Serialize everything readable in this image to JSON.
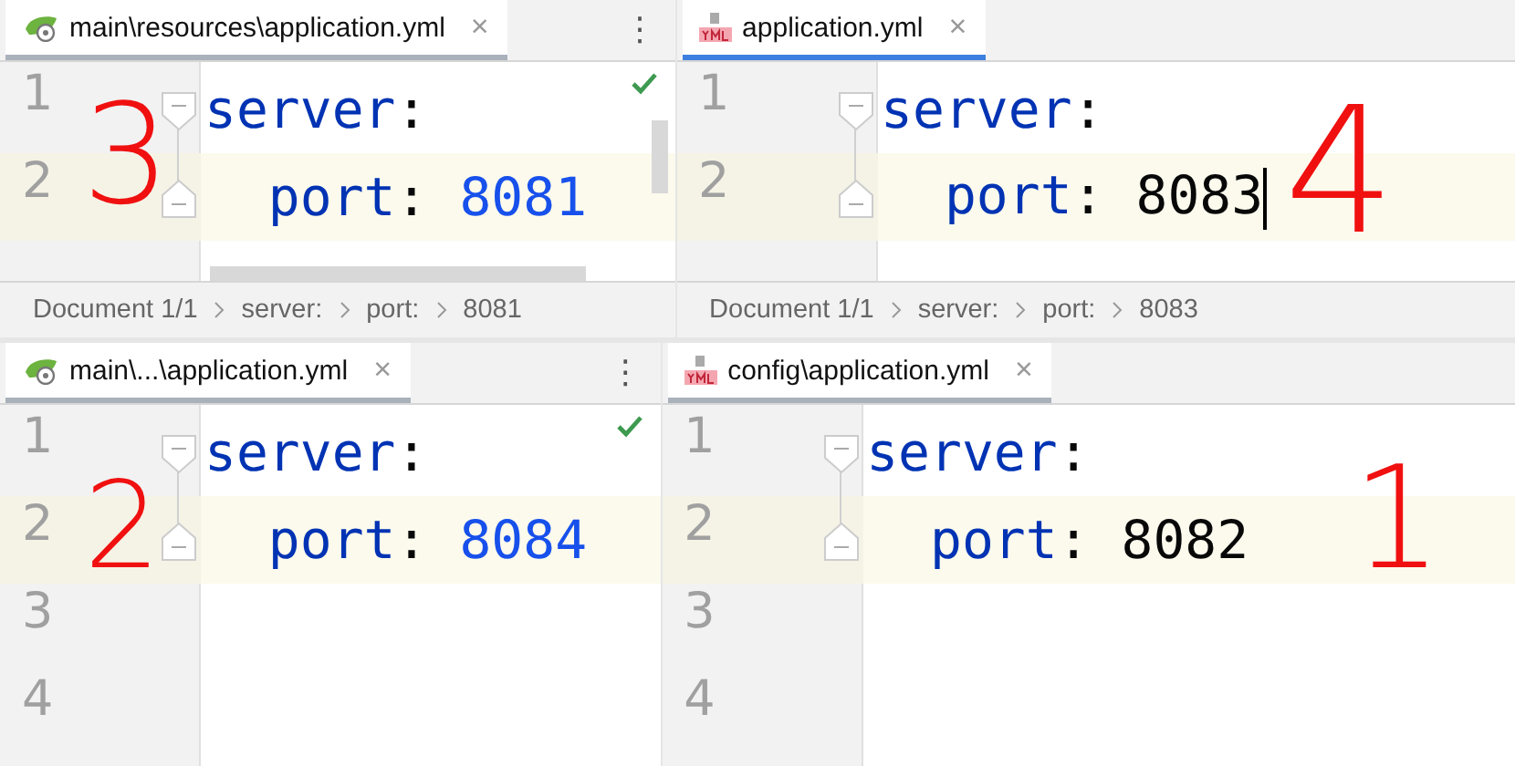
{
  "panes": [
    {
      "tab": {
        "kind": "spring",
        "label": "main\\resources\\application.yml",
        "close": "×",
        "selected": false
      },
      "menu": "⋮",
      "inspection_ok": true,
      "scrollbars": true,
      "line_numbers": [
        "1",
        "2"
      ],
      "code": [
        {
          "key": "server",
          "sep": ":",
          "current": false,
          "children": [
            {
              "key": "port",
              "sep": ":",
              "value": "8081",
              "kind": "number",
              "current": true,
              "caret": false
            }
          ]
        }
      ],
      "breadcrumbs": [
        "Document 1/1",
        "server:",
        "port:",
        "8081"
      ],
      "note": "3"
    },
    {
      "tab": {
        "kind": "yml",
        "label": "application.yml",
        "close": "×",
        "selected": true
      },
      "inspection_ok": false,
      "scrollbars": false,
      "line_numbers": [
        "1",
        "2"
      ],
      "code": [
        {
          "key": "server",
          "sep": ":",
          "current": false,
          "children": [
            {
              "key": "port",
              "sep": ":",
              "value": "8083",
              "kind": "plain",
              "current": true,
              "caret": true
            }
          ]
        }
      ],
      "breadcrumbs": [
        "Document 1/1",
        "server:",
        "port:",
        "8083"
      ],
      "note": "4"
    },
    {
      "tab": {
        "kind": "spring",
        "label": "main\\...\\application.yml",
        "close": "×",
        "selected": false
      },
      "menu": "⋮",
      "inspection_ok": true,
      "scrollbars": false,
      "line_numbers": [
        "1",
        "2",
        "3",
        "4"
      ],
      "code": [
        {
          "key": "server",
          "sep": ":",
          "current": false,
          "children": [
            {
              "key": "port",
              "sep": ":",
              "value": "8084",
              "kind": "number",
              "current": true,
              "caret": false
            }
          ]
        }
      ],
      "note": "2"
    },
    {
      "tab": {
        "kind": "yml",
        "label": "config\\application.yml",
        "close": "×",
        "selected": false
      },
      "inspection_ok": false,
      "scrollbars": false,
      "line_numbers": [
        "1",
        "2",
        "3",
        "4"
      ],
      "code": [
        {
          "key": "server",
          "sep": ":",
          "current": false,
          "children": [
            {
              "key": "port",
              "sep": ":",
              "value": "8082",
              "kind": "plain",
              "current": true,
              "caret": false
            }
          ]
        }
      ],
      "note": "1"
    }
  ]
}
